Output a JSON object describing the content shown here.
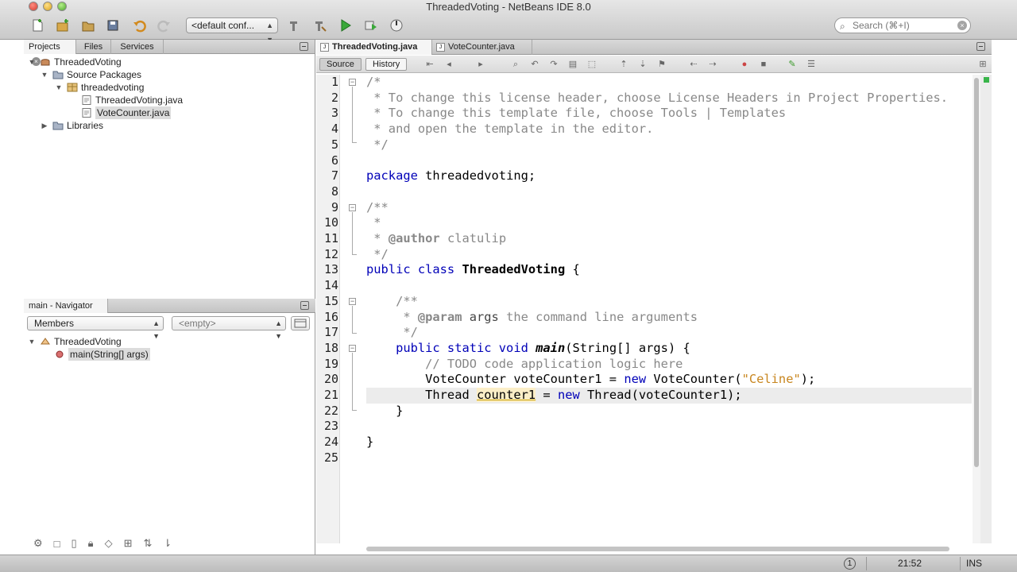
{
  "window": {
    "title": "ThreadedVoting - NetBeans IDE 8.0"
  },
  "toolbar": {
    "config_select": "<default conf...",
    "search_placeholder": "Search (⌘+I)",
    "icons": [
      "new-file-icon",
      "new-project-icon",
      "open-project-icon",
      "save-all-icon",
      "undo-icon",
      "redo-icon",
      "build-icon",
      "clean-build-icon",
      "run-icon",
      "debug-icon",
      "profile-icon"
    ]
  },
  "projects_panel": {
    "tabs": [
      "Projects",
      "Files",
      "Services"
    ],
    "tree": [
      {
        "label": "ThreadedVoting",
        "icon": "project-icon",
        "expanded": true
      },
      {
        "label": "Source Packages",
        "icon": "source-packages-icon",
        "expanded": true
      },
      {
        "label": "threadedvoting",
        "icon": "package-icon",
        "expanded": true
      },
      {
        "label": "ThreadedVoting.java",
        "icon": "java-file-icon"
      },
      {
        "label": "VoteCounter.java",
        "icon": "java-file-icon",
        "selected": true
      },
      {
        "label": "Libraries",
        "icon": "libraries-icon",
        "expanded": false
      }
    ]
  },
  "navigator_panel": {
    "title": "main - Navigator",
    "members_select": "Members",
    "filter_select": "<empty>",
    "tree": [
      {
        "label": "ThreadedVoting",
        "icon": "class-icon"
      },
      {
        "label": "main(String[] args)",
        "icon": "method-icon"
      }
    ]
  },
  "editor": {
    "tabs": [
      "ThreadedVoting.java",
      "VoteCounter.java"
    ],
    "views": [
      "Source",
      "History"
    ],
    "line_numbers": [
      "1",
      "2",
      "3",
      "4",
      "5",
      "6",
      "7",
      "8",
      "9",
      "10",
      "11",
      "12",
      "13",
      "14",
      "15",
      "16",
      "17",
      "18",
      "19",
      "20",
      "21",
      "22",
      "23",
      "24",
      "25"
    ],
    "code": {
      "l1": "/*",
      "l2": " * To change this license header, choose License Headers in Project Properties.",
      "l3": " * To change this template file, choose Tools | Templates",
      "l4": " * and open the template in the editor.",
      "l5": " */",
      "l7_kw": "package",
      "l7_rest": " threadedvoting;",
      "l9": "/**",
      "l10": " *",
      "l11_a": " * ",
      "l11_tag": "@author",
      "l11_b": " clatulip",
      "l12": " */",
      "l13_kw": "public class",
      "l13_name": "ThreadedVoting",
      "l13_rest": " {",
      "l15": "    /**",
      "l16_a": "     * ",
      "l16_tag": "@param",
      "l16_arg": " args",
      "l16_b": " the command line arguments",
      "l17": "     */",
      "l18_kw": "    public static void",
      "l18_name": "main",
      "l18_rest": "(String[] args) {",
      "l19": "        // TODO code application logic here",
      "l20_a": "        VoteCounter voteCounter1 = ",
      "l20_kw": "new",
      "l20_b": " VoteCounter(",
      "l20_str": "\"Celine\"",
      "l20_c": ");",
      "l21_a": "        Thread ",
      "l21_var": "counter1",
      "l21_b": " = ",
      "l21_kw": "new",
      "l21_c": " Thread(voteCounter1);",
      "l22": "    }",
      "l24": "}"
    }
  },
  "statusbar": {
    "notifications": "1",
    "position": "21:52",
    "mode": "INS"
  },
  "colors": {
    "keyword": "#0000b8",
    "comment": "#888888",
    "string": "#c8861f",
    "error_stripe_ok": "#39b54a"
  }
}
